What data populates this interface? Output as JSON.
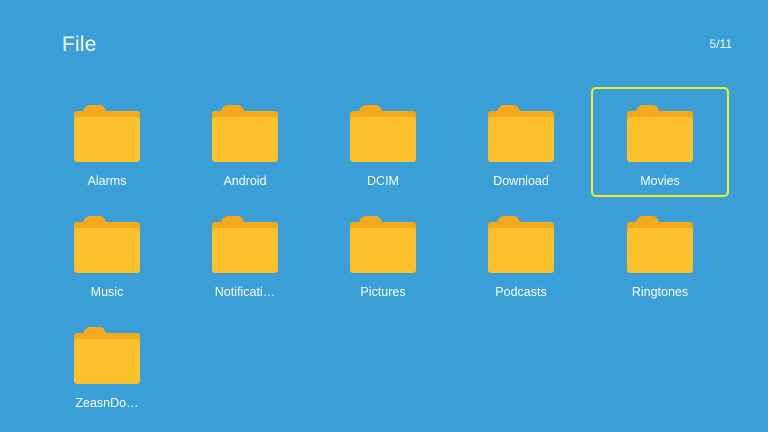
{
  "header": {
    "title": "File",
    "page_counter": "5/11"
  },
  "colors": {
    "background": "#3a9fd6",
    "folder_front": "#fcc12b",
    "folder_back": "#f3a81d",
    "selection_border": "#f1ec2c"
  },
  "icons": {
    "folder": "folder-icon"
  },
  "folders": [
    {
      "label": "Alarms",
      "selected": false
    },
    {
      "label": "Android",
      "selected": false
    },
    {
      "label": "DCIM",
      "selected": false
    },
    {
      "label": "Download",
      "selected": false
    },
    {
      "label": "Movies",
      "selected": true
    },
    {
      "label": "Music",
      "selected": false
    },
    {
      "label": "Notificati…",
      "selected": false
    },
    {
      "label": "Pictures",
      "selected": false
    },
    {
      "label": "Podcasts",
      "selected": false
    },
    {
      "label": "Ringtones",
      "selected": false
    },
    {
      "label": "ZeasnDo…",
      "selected": false
    }
  ]
}
